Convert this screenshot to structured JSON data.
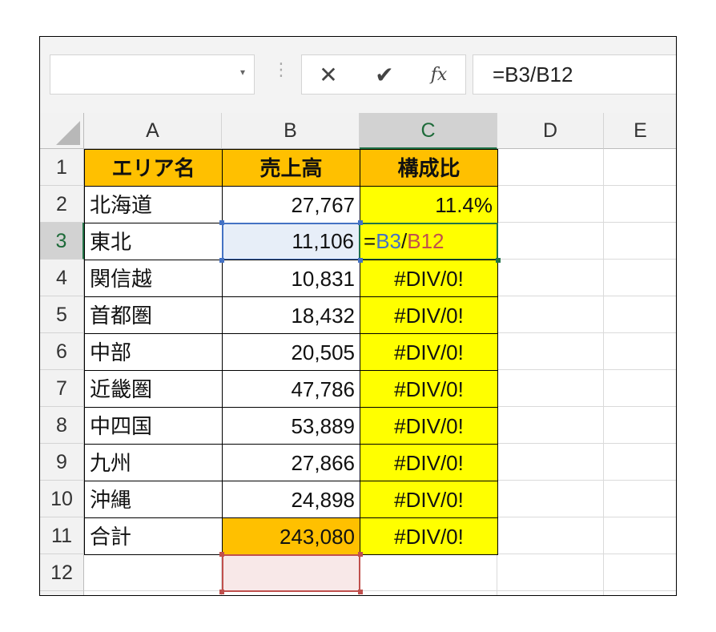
{
  "formula_bar": {
    "name_box_value": "",
    "dropdown_icon": "▾",
    "separator_icon": "⋮",
    "cancel_icon": "✕",
    "enter_icon": "✔",
    "fx_label": "fx",
    "formula": "=B3/B12"
  },
  "columns": [
    "A",
    "B",
    "C",
    "D",
    "E"
  ],
  "rows": [
    "1",
    "2",
    "3",
    "4",
    "5",
    "6",
    "7",
    "8",
    "9",
    "10",
    "11",
    "12"
  ],
  "table": {
    "header": {
      "area": "エリア名",
      "sales": "売上高",
      "ratio": "構成比"
    },
    "data": [
      {
        "area": "北海道",
        "sales": "27,767",
        "ratio": "11.4%"
      },
      {
        "area": "東北",
        "sales": "11,106",
        "ratio": ""
      },
      {
        "area": "関信越",
        "sales": "10,831",
        "ratio": "#DIV/0!"
      },
      {
        "area": "首都圏",
        "sales": "18,432",
        "ratio": "#DIV/0!"
      },
      {
        "area": "中部",
        "sales": "20,505",
        "ratio": "#DIV/0!"
      },
      {
        "area": "近畿圏",
        "sales": "47,786",
        "ratio": "#DIV/0!"
      },
      {
        "area": "中四国",
        "sales": "53,889",
        "ratio": "#DIV/0!"
      },
      {
        "area": "九州",
        "sales": "27,866",
        "ratio": "#DIV/0!"
      },
      {
        "area": "沖縄",
        "sales": "24,898",
        "ratio": "#DIV/0!"
      },
      {
        "area": "合計",
        "sales": "243,080",
        "ratio": "#DIV/0!"
      }
    ]
  },
  "editing_cell": {
    "eq": "=",
    "ref1": "B3",
    "slash": "/",
    "ref2": "B12"
  },
  "colors": {
    "header_fill": "#ffc000",
    "ratio_fill": "#ffff00",
    "total_fill": "#ffc000",
    "ref_blue": "#4472c4",
    "ref_red": "#c0504d",
    "active_green": "#217346"
  }
}
